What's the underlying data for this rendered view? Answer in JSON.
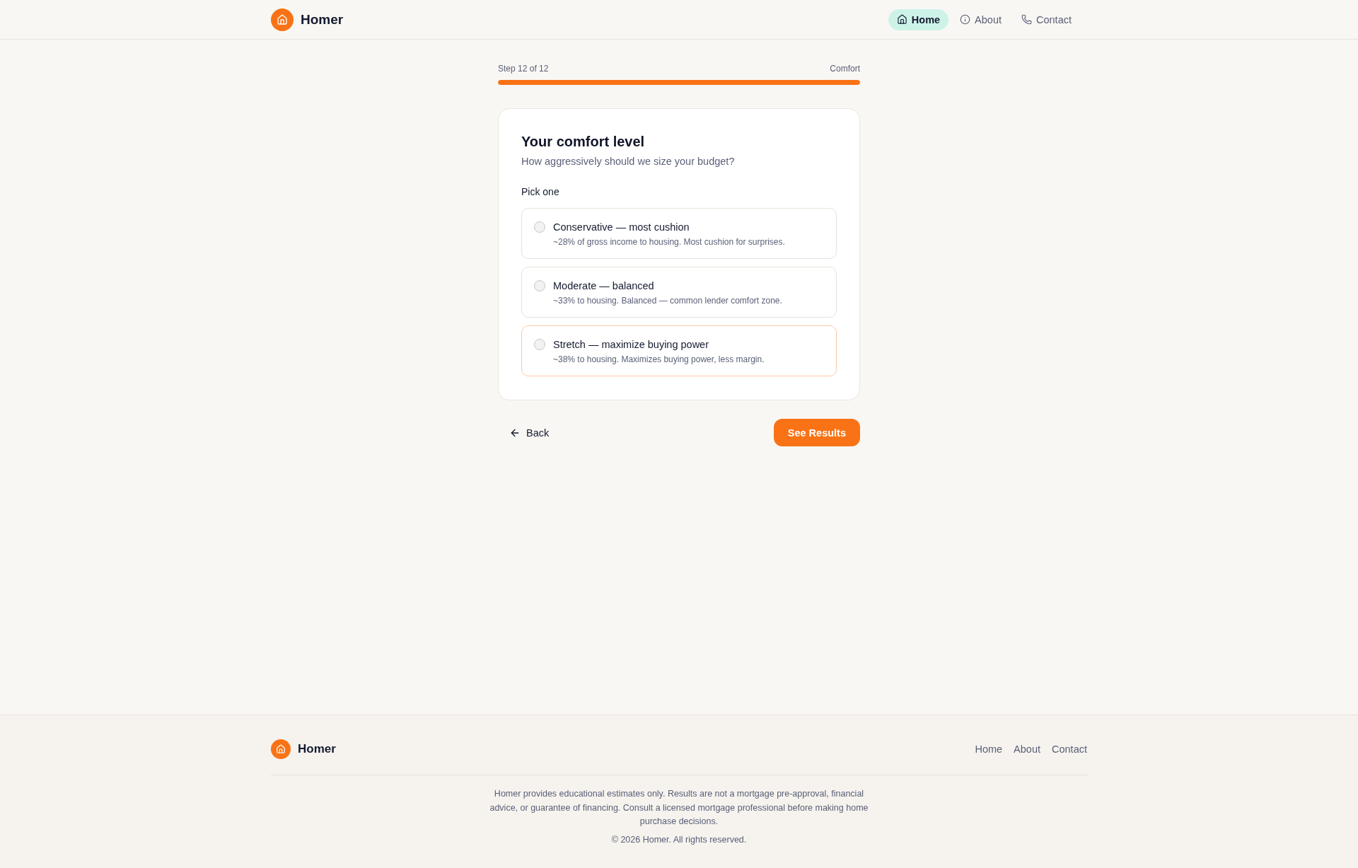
{
  "header": {
    "brand": "Homer",
    "nav": [
      {
        "label": "Home",
        "selected": true
      },
      {
        "label": "About",
        "selected": false
      },
      {
        "label": "Contact",
        "selected": false
      }
    ]
  },
  "progress": {
    "step": "Step 12 of 12",
    "section": "Comfort",
    "level": 1
  },
  "card": {
    "title": "Your comfort level",
    "subtitle": "How aggressively should we size your budget?",
    "prompt": "Pick one",
    "options": [
      {
        "title": "Conservative — most cushion",
        "description": "~28% of gross income to housing. Most cushion for surprises.",
        "selected": false,
        "hovered": false
      },
      {
        "title": "Moderate — balanced",
        "description": "~33% to housing. Balanced — common lender comfort zone.",
        "selected": false,
        "hovered": false
      },
      {
        "title": "Stretch — maximize buying power",
        "description": "~38% to housing. Maximizes buying power, less margin.",
        "selected": false,
        "hovered": true
      }
    ]
  },
  "actions": {
    "back": "Back",
    "next": "See Results"
  },
  "footer": {
    "brand": "Homer",
    "links": [
      "Home",
      "About",
      "Contact"
    ],
    "disclaimer": "Homer provides educational estimates only. Results are not a mortgage pre-approval, financial advice, or guarantee of financing. Consult a licensed mortgage professional before making home purchase decisions.",
    "copyright": "© 2026 Homer. All rights reserved."
  }
}
